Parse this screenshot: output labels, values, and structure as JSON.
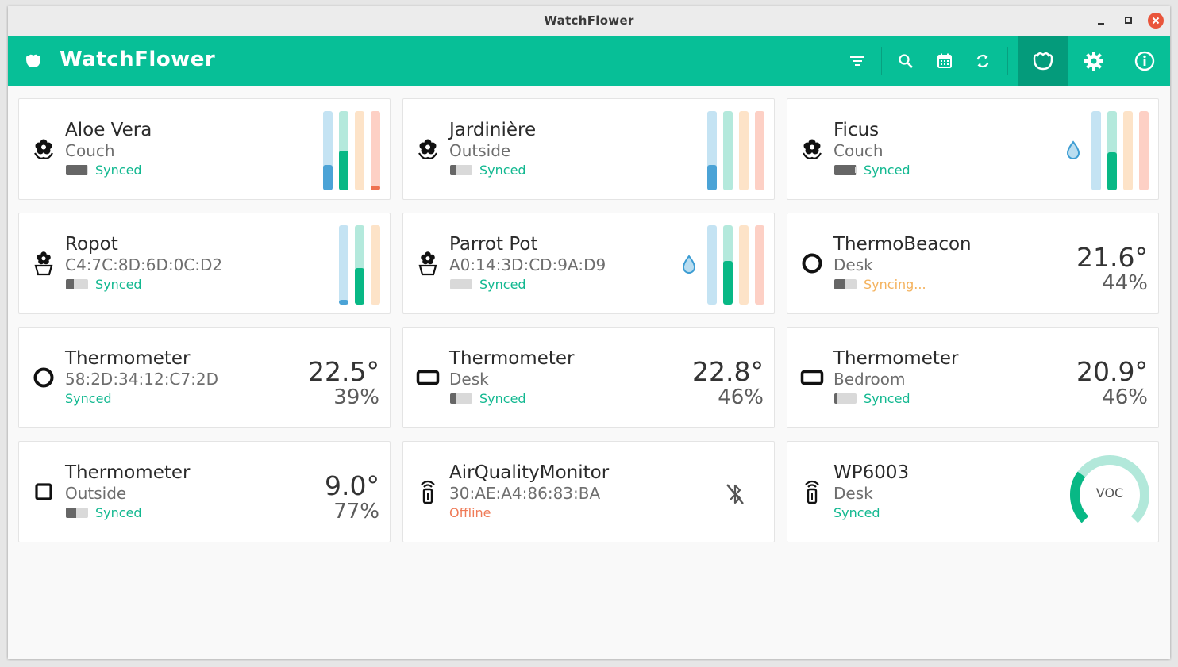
{
  "window": {
    "title": "WatchFlower"
  },
  "header": {
    "app_name": "WatchFlower",
    "accent": "#07bf97",
    "buttons": [
      "filter-icon",
      "search-icon",
      "calendar-icon",
      "sync-icon",
      "plants-icon",
      "gear-icon",
      "info-icon"
    ]
  },
  "colors": {
    "water": "#4ba3d6",
    "water_bg": "#c4e3f3",
    "fert": "#08b885",
    "fert_bg": "#b4e9dc",
    "temp": "#f7c88f",
    "temp_bg": "#fde3c8",
    "light": "#ee7050",
    "light_bg": "#fdd0c5",
    "synced": "#12b890",
    "syncing": "#f4b25d",
    "offline": "#ef7b58"
  },
  "devices": [
    {
      "name": "Aloe Vera",
      "location": "Couch",
      "status": "Synced",
      "status_type": "ok",
      "icon": "flower-icon",
      "battery": 0.95,
      "bars": [
        0.32,
        0.5,
        0.0,
        0.06
      ]
    },
    {
      "name": "Jardinière",
      "location": "Outside",
      "status": "Synced",
      "status_type": "ok",
      "icon": "flower-icon",
      "battery": 0.3,
      "bars": [
        0.32,
        0.0,
        0.0,
        0.0
      ]
    },
    {
      "name": "Ficus",
      "location": "Couch",
      "status": "Synced",
      "status_type": "ok",
      "icon": "flower-icon",
      "battery": 0.95,
      "bars": [
        0.0,
        0.48,
        0.0,
        0.0
      ],
      "water_alert": true
    },
    {
      "name": "Ropot",
      "location": "C4:7C:8D:6D:0C:D2",
      "status": "Synced",
      "status_type": "ok",
      "icon": "flower-pot-icon",
      "battery": 0.35,
      "bars": [
        0.06,
        0.46,
        0.0
      ]
    },
    {
      "name": "Parrot Pot",
      "location": "A0:14:3D:CD:9A:D9",
      "status": "Synced",
      "status_type": "ok",
      "icon": "flower-pot-icon",
      "battery": 0.0,
      "bars": [
        0.0,
        0.55,
        0.0,
        0.0
      ],
      "water_alert": true
    },
    {
      "name": "ThermoBeacon",
      "location": "Desk",
      "status": "Syncing...",
      "status_type": "warn",
      "icon": "ring-icon",
      "battery": 0.45,
      "temperature": "21.6°",
      "humidity": "44%"
    },
    {
      "name": "Thermometer",
      "location": "58:2D:34:12:C7:2D",
      "status": "Synced",
      "status_type": "ok",
      "icon": "ring-icon",
      "no_battery": true,
      "temperature": "22.5°",
      "humidity": "39%"
    },
    {
      "name": "Thermometer",
      "location": "Desk",
      "status": "Synced",
      "status_type": "ok",
      "icon": "rect-thermometer-icon",
      "battery": 0.25,
      "temperature": "22.8°",
      "humidity": "46%"
    },
    {
      "name": "Thermometer",
      "location": "Bedroom",
      "status": "Synced",
      "status_type": "ok",
      "icon": "rect-thermometer-icon",
      "battery": 0.12,
      "temperature": "20.9°",
      "humidity": "46%"
    },
    {
      "name": "Thermometer",
      "location": "Outside",
      "status": "Synced",
      "status_type": "ok",
      "icon": "square-thermometer-icon",
      "battery": 0.45,
      "temperature": "9.0°",
      "humidity": "77%"
    },
    {
      "name": "AirQualityMonitor",
      "location": "30:AE:A4:86:83:BA",
      "status": "Offline",
      "status_type": "off",
      "icon": "air-monitor-icon",
      "no_battery": true,
      "bluetooth_off": true
    },
    {
      "name": "WP6003",
      "location": "Desk",
      "status": "Synced",
      "status_type": "ok",
      "icon": "air-monitor-icon",
      "no_battery": true,
      "gauge_label": "VOC",
      "gauge_level": 0.3
    }
  ]
}
